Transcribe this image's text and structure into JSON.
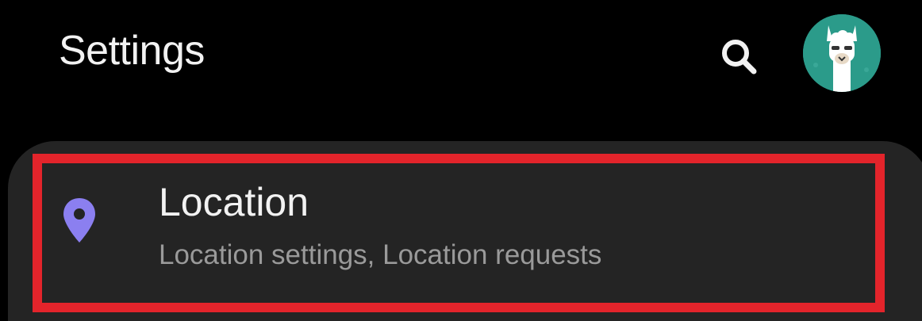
{
  "header": {
    "title": "Settings",
    "search_icon": "search-icon",
    "avatar_icon": "llama-avatar"
  },
  "location_item": {
    "title": "Location",
    "subtitle": "Location settings, Location requests",
    "icon": "location-pin-icon"
  },
  "colors": {
    "background": "#000000",
    "card": "#242424",
    "highlight_border": "#e3242b",
    "pin": "#8b7ff0",
    "avatar_bg": "#2b9b8a",
    "title_text": "#f2f2f2",
    "subtitle_text": "#9a9a9a"
  }
}
